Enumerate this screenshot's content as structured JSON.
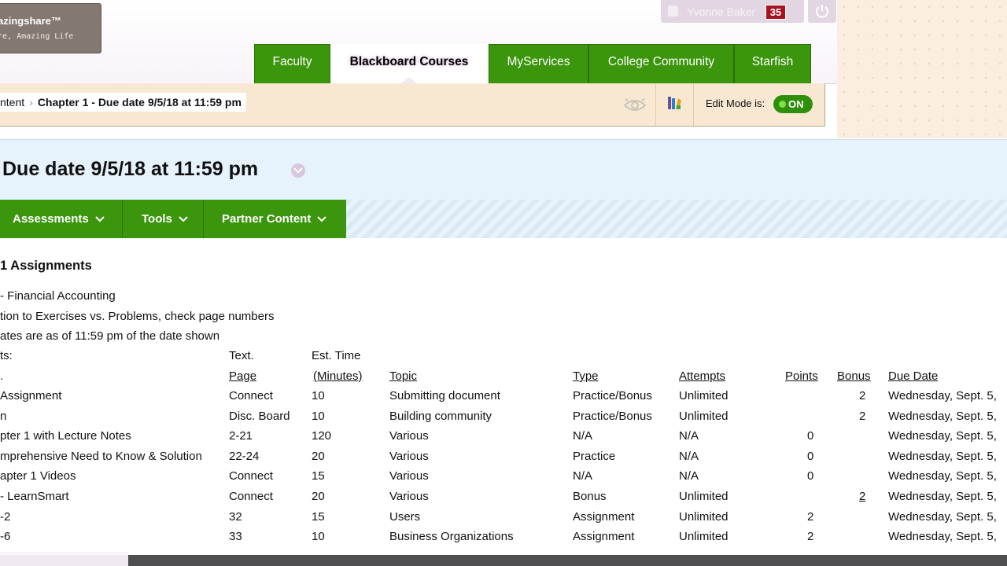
{
  "brand": {
    "line1": "azingshare™",
    "line2": "re, Amazing Life"
  },
  "user": {
    "name": "Yvonne Baker",
    "notifications": "35"
  },
  "nav_tabs": [
    {
      "label": "Faculty",
      "active": false
    },
    {
      "label": "Blackboard Courses",
      "active": true
    },
    {
      "label": "MyServices",
      "active": false
    },
    {
      "label": "College Community",
      "active": false
    },
    {
      "label": "Starfish",
      "active": false
    }
  ],
  "breadcrumb": {
    "parent": "ntent",
    "current": "Chapter 1 - Due date 9/5/18 at 11:59 pm"
  },
  "edit_mode": {
    "label": "Edit Mode is:",
    "state": "ON"
  },
  "page": {
    "title": "Due date 9/5/18 at 11:59 pm"
  },
  "actions": [
    "Assessments",
    "Tools",
    "Partner Content"
  ],
  "item": {
    "title": "1 Assignments",
    "intro": [
      "- Financial Accounting",
      "tion to Exercises vs. Problems, check page numbers",
      "ates are as of 11:59 pm of the date shown",
      "ts:"
    ]
  },
  "table": {
    "header_top": {
      "page": "Text.",
      "time": "Est. Time"
    },
    "header": {
      "name": ".",
      "page": "Page",
      "time": "(Minutes)",
      "topic": "Topic",
      "type": "Type",
      "attempts": "Attempts",
      "points": "Points",
      "bonus": "Bonus",
      "due": "Due Date"
    },
    "rows": [
      {
        "name": " Assignment",
        "page": "Connect",
        "time": "10",
        "topic": "Submitting document",
        "type": "Practice/Bonus",
        "attempts": "Unlimited",
        "points": "",
        "bonus": "2",
        "due": "Wednesday, Sept. 5,"
      },
      {
        "name": "n",
        "page": "Disc. Board",
        "time": "10",
        "topic": "Building community",
        "type": "Practice/Bonus",
        "attempts": "Unlimited",
        "points": "",
        "bonus": "2",
        "due": "Wednesday, Sept. 5,"
      },
      {
        "name": "pter 1 with Lecture   Notes",
        "page": "2-21",
        "time": "120",
        "topic": "Various",
        "type": "N/A",
        "attempts": "N/A",
        "points": "0",
        "bonus": "",
        "due": "Wednesday, Sept. 5,"
      },
      {
        "name": "mprehensive Need to   Know & Solution",
        "page": "22-24",
        "time": "20",
        "topic": "Various",
        "type": "Practice",
        "attempts": "N/A",
        "points": "0",
        "bonus": "",
        "due": "Wednesday, Sept. 5,"
      },
      {
        "name": "apter 1 Videos",
        "page": "Connect",
        "time": "15",
        "topic": "Various",
        "type": "N/A",
        "attempts": "N/A",
        "points": "0",
        "bonus": "",
        "due": "Wednesday, Sept. 5,"
      },
      {
        "name": "- LearnSmart",
        "page": "Connect",
        "time": "20",
        "topic": "Various",
        "type": "Bonus",
        "attempts": "Unlimited",
        "points": "",
        "bonus": "2",
        "due": "Wednesday, Sept. 5,"
      },
      {
        "name": "-2",
        "page": "32",
        "time": "15",
        "topic": "Users",
        "type": "Assignment",
        "attempts": "Unlimited",
        "points": "2",
        "bonus": "",
        "due": "Wednesday, Sept. 5,"
      },
      {
        "name": "-6",
        "page": "33",
        "time": "10",
        "topic": "Business Organizations",
        "type": "Assignment",
        "attempts": "Unlimited",
        "points": "2",
        "bonus": "",
        "due": "Wednesday, Sept. 5,"
      }
    ]
  },
  "colors": {
    "nav_green": "#3b950d",
    "header_blue": "#e6f3fc",
    "crumb_tan": "#f8e8d2",
    "badge_red": "#a5131f"
  }
}
